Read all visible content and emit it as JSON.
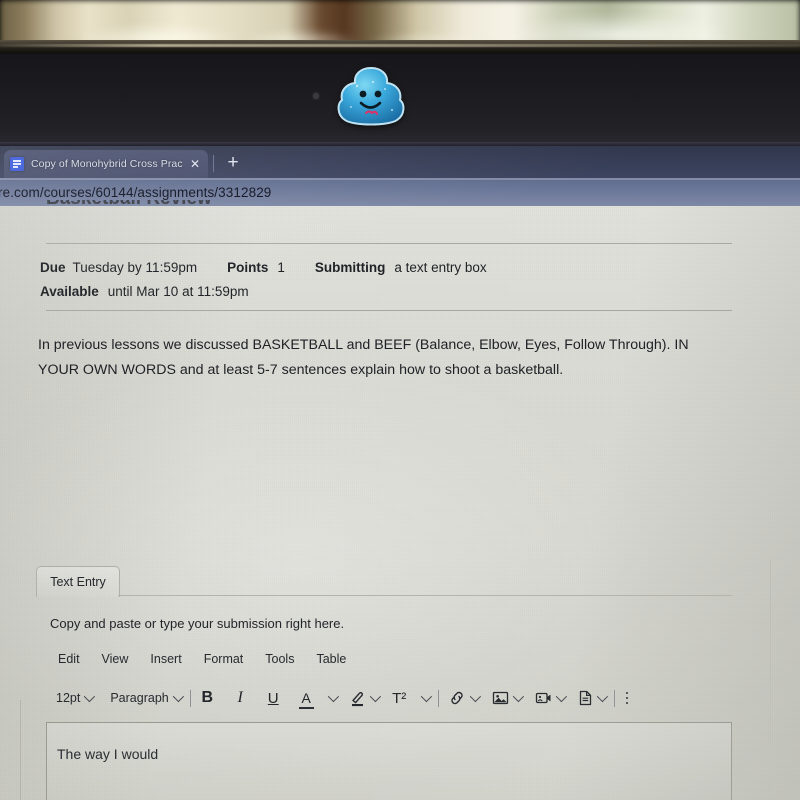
{
  "browser": {
    "tab": {
      "title": "Copy of Monohybrid Cross Pract",
      "favicon": "document-icon",
      "close_label": "✕"
    },
    "new_tab_label": "+",
    "url": "re.com/courses/60144/assignments/3312829"
  },
  "page": {
    "clipped_heading": "Basketball Review",
    "meta": {
      "due_label": "Due",
      "due_value": "Tuesday by 11:59pm",
      "points_label": "Points",
      "points_value": "1",
      "submitting_label": "Submitting",
      "submitting_value": "a text entry box",
      "available_label": "Available",
      "available_value": "until Mar 10 at 11:59pm"
    },
    "description": "In previous lessons we discussed BASKETBALL and BEEF (Balance, Elbow, Eyes, Follow Through). IN YOUR OWN WORDS and at least 5-7 sentences explain how to shoot a basketball."
  },
  "submission": {
    "tab_label": "Text Entry",
    "hint": "Copy and paste or type your submission right here.",
    "editor": {
      "menus": [
        "Edit",
        "View",
        "Insert",
        "Format",
        "Tools",
        "Table"
      ],
      "font_size": "12pt",
      "block_format": "Paragraph",
      "buttons": {
        "bold": "B",
        "italic": "I",
        "underline": "U",
        "text_color": "A",
        "highlight": "highlighter-icon",
        "superscript": "T²",
        "link": "link-icon",
        "image": "image-icon",
        "media": "media-icon",
        "document": "document-icon",
        "more": "kebab-menu-icon"
      },
      "content": "The way I would"
    }
  },
  "hardware": {
    "sticker": "blue-glitter-poop-sticker",
    "webcam": "webcam-lens"
  },
  "colors": {
    "tabbar": "#373e57",
    "urlbar": "#6c7899",
    "page_bg": "#dcdcd6",
    "favicon": "#3b5bdb",
    "sticker": "#2f9fd4"
  }
}
